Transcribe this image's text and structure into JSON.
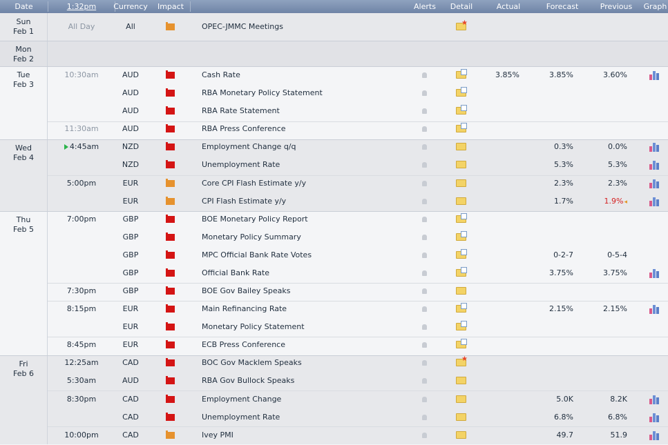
{
  "header": {
    "date": "Date",
    "time": "1:32pm",
    "currency": "Currency",
    "impact": "Impact",
    "alerts": "Alerts",
    "detail": "Detail",
    "actual": "Actual",
    "forecast": "Forecast",
    "previous": "Previous",
    "graph": "Graph"
  },
  "colors": {
    "high_impact": "#d41414",
    "medium_impact": "#e6922e",
    "revised": "#d42020",
    "header": "#7d90b0"
  },
  "days": [
    {
      "dow": "Sun",
      "date": "Feb 1"
    },
    {
      "dow": "Mon",
      "date": "Feb 2"
    },
    {
      "dow": "Tue",
      "date": "Feb 3"
    },
    {
      "dow": "Wed",
      "date": "Feb 4"
    },
    {
      "dow": "Thu",
      "date": "Feb 5"
    },
    {
      "dow": "Fri",
      "date": "Feb 6"
    }
  ],
  "events": [
    {
      "time": "All Day",
      "currency": "All",
      "impact": "medium",
      "event": "OPEC-JMMC Meetings",
      "detail_icon": "folder-star-icon",
      "actual": "",
      "forecast": "",
      "previous": "",
      "graph": false,
      "alert": false
    },
    {
      "time": "10:30am",
      "currency": "AUD",
      "impact": "high",
      "event": "Cash Rate",
      "detail_icon": "folder-doc-icon",
      "actual": "3.85%",
      "forecast": "3.85%",
      "previous": "3.60%",
      "graph": true,
      "alert": true
    },
    {
      "time": "",
      "currency": "AUD",
      "impact": "high",
      "event": "RBA Monetary Policy Statement",
      "detail_icon": "folder-doc-icon",
      "actual": "",
      "forecast": "",
      "previous": "",
      "graph": false,
      "alert": true
    },
    {
      "time": "",
      "currency": "AUD",
      "impact": "high",
      "event": "RBA Rate Statement",
      "detail_icon": "folder-doc-icon",
      "actual": "",
      "forecast": "",
      "previous": "",
      "graph": false,
      "alert": true
    },
    {
      "time": "11:30am",
      "currency": "AUD",
      "impact": "high",
      "event": "RBA Press Conference",
      "detail_icon": "folder-doc-icon",
      "actual": "",
      "forecast": "",
      "previous": "",
      "graph": false,
      "alert": true
    },
    {
      "time": "4:45am",
      "currency": "NZD",
      "impact": "high",
      "event": "Employment Change q/q",
      "detail_icon": "folder-icon",
      "actual": "",
      "forecast": "0.3%",
      "previous": "0.0%",
      "graph": true,
      "alert": true
    },
    {
      "time": "",
      "currency": "NZD",
      "impact": "high",
      "event": "Unemployment Rate",
      "detail_icon": "folder-icon",
      "actual": "",
      "forecast": "5.3%",
      "previous": "5.3%",
      "graph": true,
      "alert": true
    },
    {
      "time": "5:00pm",
      "currency": "EUR",
      "impact": "medium",
      "event": "Core CPI Flash Estimate y/y",
      "detail_icon": "folder-icon",
      "actual": "",
      "forecast": "2.3%",
      "previous": "2.3%",
      "graph": true,
      "alert": true
    },
    {
      "time": "",
      "currency": "EUR",
      "impact": "medium",
      "event": "CPI Flash Estimate y/y",
      "detail_icon": "folder-icon",
      "actual": "",
      "forecast": "1.7%",
      "previous": "1.9%",
      "graph": true,
      "alert": true
    },
    {
      "time": "7:00pm",
      "currency": "GBP",
      "impact": "high",
      "event": "BOE Monetary Policy Report",
      "detail_icon": "folder-doc-icon",
      "actual": "",
      "forecast": "",
      "previous": "",
      "graph": false,
      "alert": true
    },
    {
      "time": "",
      "currency": "GBP",
      "impact": "high",
      "event": "Monetary Policy Summary",
      "detail_icon": "folder-doc-icon",
      "actual": "",
      "forecast": "",
      "previous": "",
      "graph": false,
      "alert": true
    },
    {
      "time": "",
      "currency": "GBP",
      "impact": "high",
      "event": "MPC Official Bank Rate Votes",
      "detail_icon": "folder-doc-icon",
      "actual": "",
      "forecast": "0-2-7",
      "previous": "0-5-4",
      "graph": false,
      "alert": true
    },
    {
      "time": "",
      "currency": "GBP",
      "impact": "high",
      "event": "Official Bank Rate",
      "detail_icon": "folder-doc-icon",
      "actual": "",
      "forecast": "3.75%",
      "previous": "3.75%",
      "graph": true,
      "alert": true
    },
    {
      "time": "7:30pm",
      "currency": "GBP",
      "impact": "high",
      "event": "BOE Gov Bailey Speaks",
      "detail_icon": "folder-icon",
      "actual": "",
      "forecast": "",
      "previous": "",
      "graph": false,
      "alert": true
    },
    {
      "time": "8:15pm",
      "currency": "EUR",
      "impact": "high",
      "event": "Main Refinancing Rate",
      "detail_icon": "folder-doc-icon",
      "actual": "",
      "forecast": "2.15%",
      "previous": "2.15%",
      "graph": true,
      "alert": true
    },
    {
      "time": "",
      "currency": "EUR",
      "impact": "high",
      "event": "Monetary Policy Statement",
      "detail_icon": "folder-doc-icon",
      "actual": "",
      "forecast": "",
      "previous": "",
      "graph": false,
      "alert": true
    },
    {
      "time": "8:45pm",
      "currency": "EUR",
      "impact": "high",
      "event": "ECB Press Conference",
      "detail_icon": "folder-doc-icon",
      "actual": "",
      "forecast": "",
      "previous": "",
      "graph": false,
      "alert": true
    },
    {
      "time": "12:25am",
      "currency": "CAD",
      "impact": "high",
      "event": "BOC Gov Macklem Speaks",
      "detail_icon": "folder-star-icon",
      "actual": "",
      "forecast": "",
      "previous": "",
      "graph": false,
      "alert": true
    },
    {
      "time": "5:30am",
      "currency": "AUD",
      "impact": "high",
      "event": "RBA Gov Bullock Speaks",
      "detail_icon": "folder-icon",
      "actual": "",
      "forecast": "",
      "previous": "",
      "graph": false,
      "alert": true
    },
    {
      "time": "8:30pm",
      "currency": "CAD",
      "impact": "high",
      "event": "Employment Change",
      "detail_icon": "folder-icon",
      "actual": "",
      "forecast": "5.0K",
      "previous": "8.2K",
      "graph": true,
      "alert": true
    },
    {
      "time": "",
      "currency": "CAD",
      "impact": "high",
      "event": "Unemployment Rate",
      "detail_icon": "folder-icon",
      "actual": "",
      "forecast": "6.8%",
      "previous": "6.8%",
      "graph": true,
      "alert": true
    },
    {
      "time": "10:00pm",
      "currency": "CAD",
      "impact": "medium",
      "event": "Ivey PMI",
      "detail_icon": "folder-icon",
      "actual": "",
      "forecast": "49.7",
      "previous": "51.9",
      "graph": true,
      "alert": true
    }
  ]
}
